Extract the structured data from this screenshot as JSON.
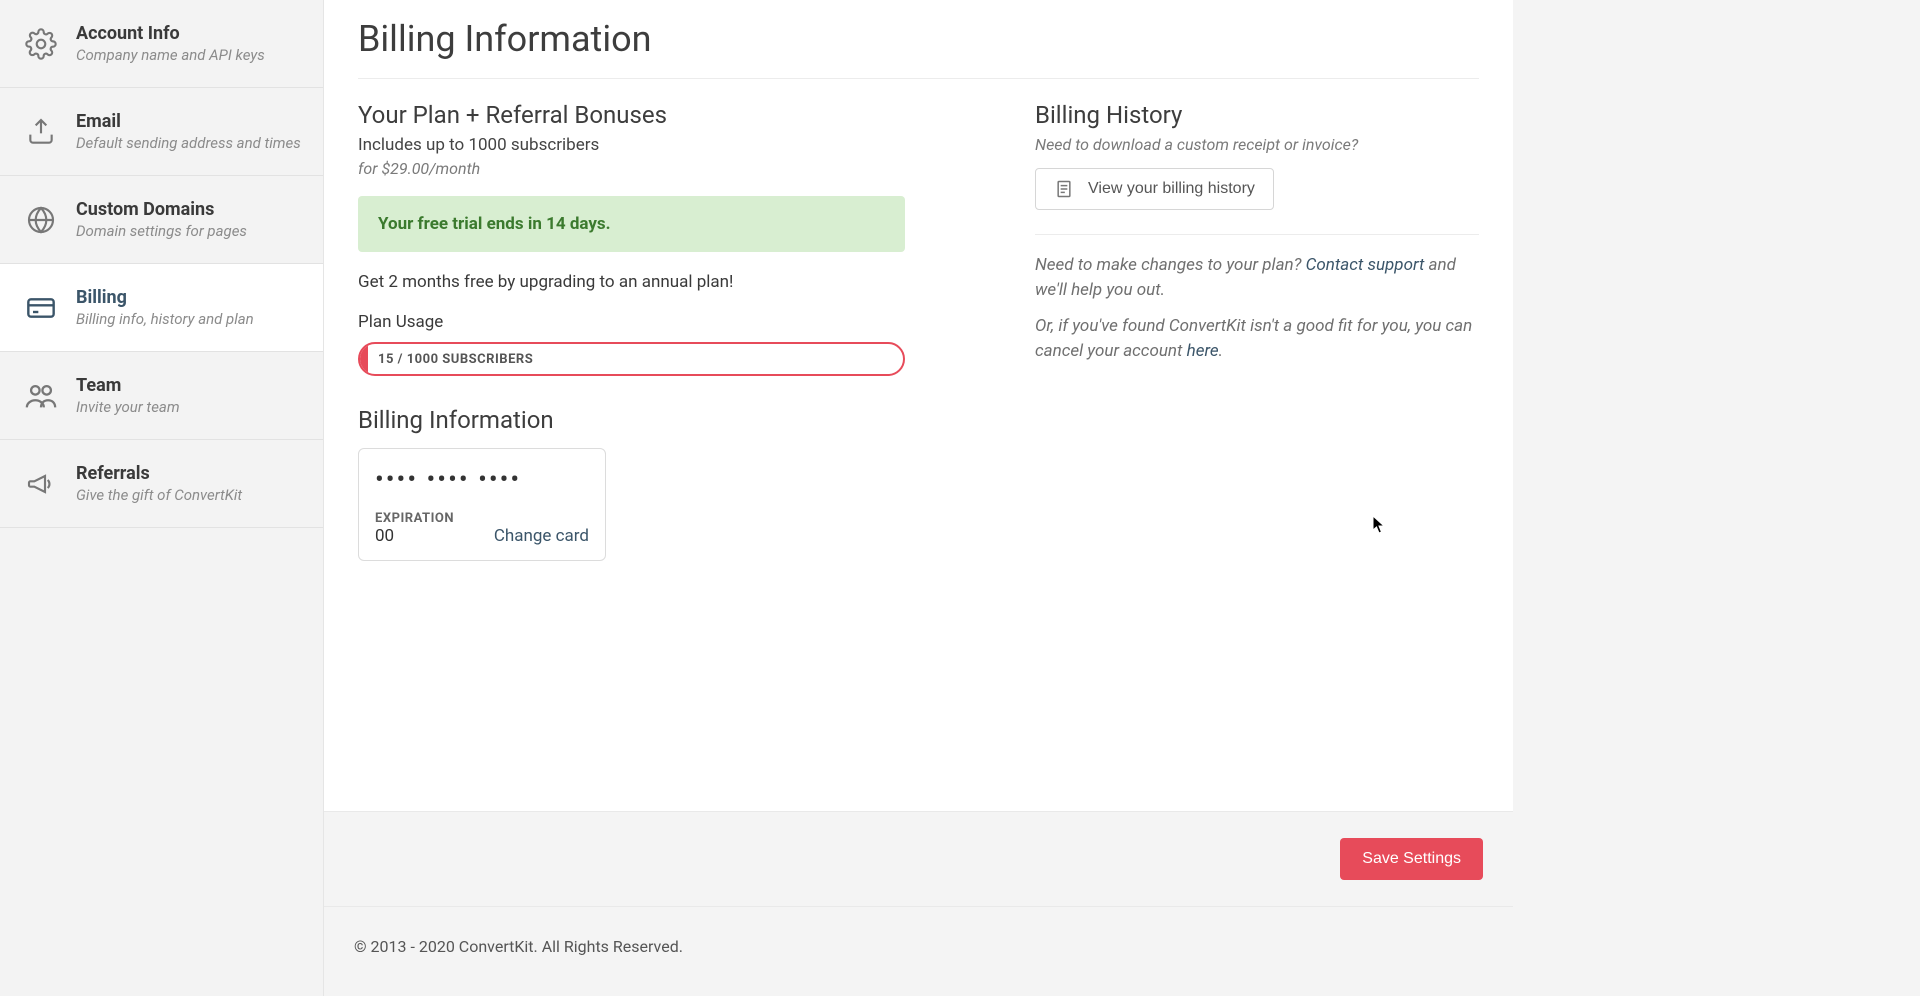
{
  "sidebar": {
    "items": [
      {
        "title": "Account Info",
        "sub": "Company name and API keys",
        "icon": "gear-icon"
      },
      {
        "title": "Email",
        "sub": "Default sending address and times",
        "icon": "upload-icon"
      },
      {
        "title": "Custom Domains",
        "sub": "Domain settings for pages",
        "icon": "globe-icon"
      },
      {
        "title": "Billing",
        "sub": "Billing info, history and plan",
        "icon": "card-icon",
        "active": true
      },
      {
        "title": "Team",
        "sub": "Invite your team",
        "icon": "team-icon"
      },
      {
        "title": "Referrals",
        "sub": "Give the gift of ConvertKit",
        "icon": "megaphone-icon"
      }
    ]
  },
  "page": {
    "title": "Billing Information"
  },
  "plan": {
    "heading": "Your Plan + Referral Bonuses",
    "includes": "Includes up to 1000 subscribers",
    "price": "for $29.00/month",
    "trial_alert": "Your free trial ends in 14 days.",
    "upsell": "Get 2 months free by upgrading to an annual plan!",
    "usage_label": "Plan Usage",
    "usage_text": "15 / 1000 SUBSCRIBERS",
    "usage_pct": 1.5
  },
  "billing_info": {
    "heading": "Billing Information",
    "card_masked": "•••• •••• ••••",
    "exp_label": "EXPIRATION",
    "exp_value": "00",
    "change_label": "Change card"
  },
  "history": {
    "heading": "Billing History",
    "sub": "Need to download a custom receipt or invoice?",
    "button": "View your billing history",
    "change_prefix": "Need to make changes to your plan? ",
    "contact_link": "Contact support",
    "change_suffix": " and we'll help you out.",
    "cancel_prefix": "Or, if you've found ConvertKit isn't a good fit for you, you can cancel your account ",
    "cancel_link": "here",
    "cancel_suffix": "."
  },
  "actions": {
    "save": "Save Settings"
  },
  "footer": {
    "copyright": "© 2013 - 2020 ConvertKit. All Rights Reserved."
  }
}
